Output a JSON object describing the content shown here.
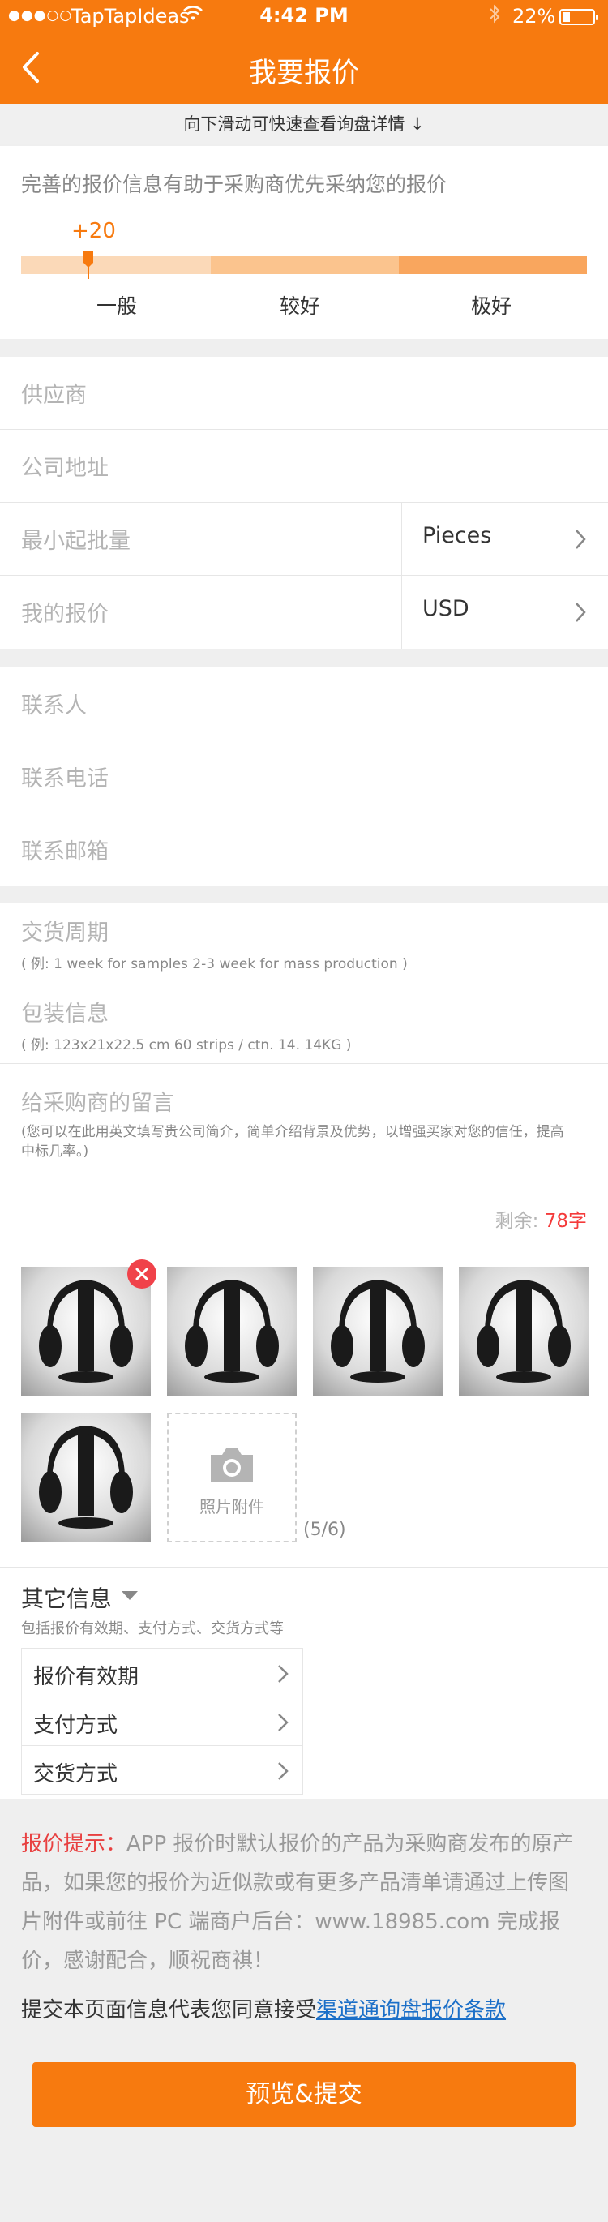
{
  "status_bar": {
    "signal_dots": "●●●○○",
    "carrier": "TapTapIdeas",
    "time": "4:42 PM",
    "battery": "22%"
  },
  "nav": {
    "title": "我要报价"
  },
  "hint": {
    "text": "向下滑动可快速查看询盘详情 ↓"
  },
  "rating": {
    "tip": "完善的报价信息有助于采购商优先采纳您的报价",
    "score": "+20",
    "levels": [
      "一般",
      "较好",
      "极好"
    ]
  },
  "form1": {
    "supplier": "供应商",
    "address": "公司地址",
    "moq": "最小起批量",
    "moq_unit": "Pieces",
    "price": "我的报价",
    "currency": "USD"
  },
  "form2": {
    "contact": "联系人",
    "phone": "联系电话",
    "email": "联系邮箱"
  },
  "form3": {
    "delivery": "交货周期",
    "delivery_ex": "( 例: 1 week for samples 2-3 week for mass production )",
    "packing": "包装信息",
    "packing_ex": "( 例: 123x21x22.5 cm 60 strips / ctn. 14. 14KG )",
    "message": "给采购商的留言",
    "message_ex": "(您可以在此用英文填写贵公司简介，简单介绍背景及优势，以增强买家对您的信任，提高中标几率。)",
    "remain_label": "剩余: ",
    "remain_count": "78字"
  },
  "photos": {
    "add_label": "照片附件",
    "count": "(5/6)"
  },
  "other": {
    "title": "其它信息",
    "subtitle": "包括报价有效期、支付方式、交货方式等",
    "items": [
      "报价有效期",
      "支付方式",
      "交货方式"
    ]
  },
  "notice": {
    "label": "报价提示：",
    "text": "APP 报价时默认报价的产品为采购商发布的原产品，如果您的报价为近似款或有更多产品清单请通过上传图片附件或前往 PC 端商户后台：www.18985.com 完成报价，感谢配合，顺祝商祺！"
  },
  "agreement": {
    "text": "提交本页面信息代表您同意接受",
    "link": "渠道通询盘报价条款"
  },
  "submit": {
    "label": "预览&提交"
  }
}
